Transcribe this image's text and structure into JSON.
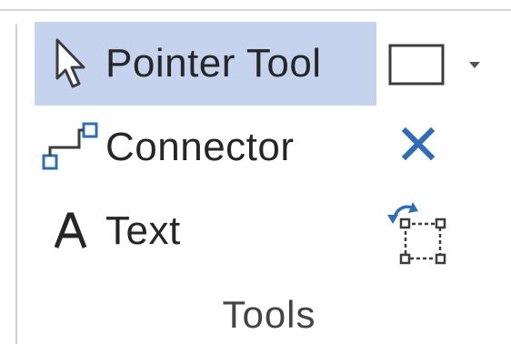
{
  "group": {
    "label": "Tools"
  },
  "tools": [
    {
      "label": "Pointer Tool",
      "icon": "pointer-arrow-icon",
      "selected": true
    },
    {
      "label": "Connector",
      "icon": "connector-icon",
      "selected": false
    },
    {
      "label": "Text",
      "icon": "text-a-icon",
      "selected": false
    }
  ],
  "side_buttons": [
    {
      "icon": "rectangle-shape-icon"
    },
    {
      "icon": "dropdown-arrow-icon"
    },
    {
      "icon": "delete-x-icon"
    },
    {
      "icon": "rotate-position-icon"
    }
  ],
  "colors": {
    "selected_background": "#c5d3ef",
    "accent_blue": "#2f6db5",
    "text": "#262626"
  }
}
